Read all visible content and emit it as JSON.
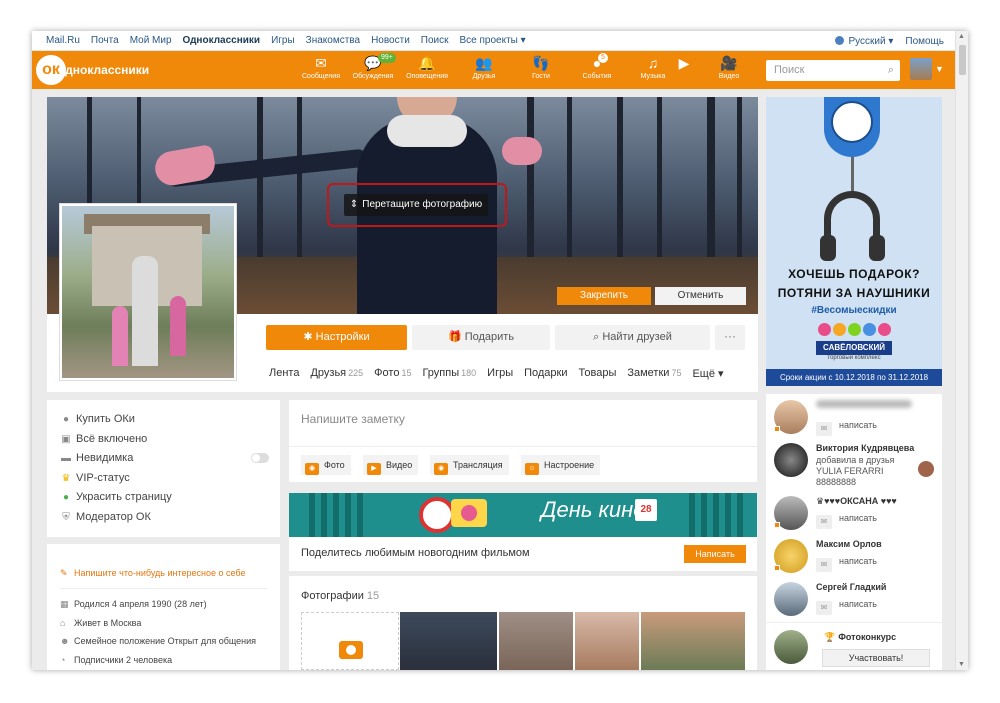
{
  "toplinks": {
    "items": [
      "Mail.Ru",
      "Почта",
      "Мой Мир",
      "Одноклассники",
      "Игры",
      "Знакомства",
      "Новости",
      "Поиск",
      "Все проекты ▾"
    ],
    "language": "Русский ▾",
    "help": "Помощь"
  },
  "header": {
    "logo_text": "одноклассники",
    "nav": [
      {
        "label": "Сообщения",
        "icon": "envelope-icon"
      },
      {
        "label": "Обсуждения",
        "icon": "chat-icon",
        "badge": "99+"
      },
      {
        "label": "Оповещения",
        "icon": "bell-icon"
      },
      {
        "label": "Друзья",
        "icon": "friends-icon"
      },
      {
        "label": "Гости",
        "icon": "footprints-icon"
      },
      {
        "label": "События",
        "icon": "events-icon",
        "badge": "5"
      },
      {
        "label": "Музыка",
        "icon": "music-icon"
      },
      {
        "label": "Видео",
        "icon": "video-icon"
      }
    ],
    "search_placeholder": "Поиск"
  },
  "cover": {
    "drag_label": "Перетащите фотографию",
    "fix_label": "Закрепить",
    "cancel_label": "Отменить"
  },
  "profile": {
    "settings_label": "Настройки",
    "gift_label": "Подарить",
    "find_friends_label": "Найти друзей",
    "more_label": "···",
    "tabs": [
      {
        "label": "Лента",
        "count": ""
      },
      {
        "label": "Друзья",
        "count": "225"
      },
      {
        "label": "Фото",
        "count": "15"
      },
      {
        "label": "Группы",
        "count": "180"
      },
      {
        "label": "Игры",
        "count": ""
      },
      {
        "label": "Подарки",
        "count": ""
      },
      {
        "label": "Товары",
        "count": ""
      },
      {
        "label": "Заметки",
        "count": "75"
      },
      {
        "label": "Ещё ▾",
        "count": ""
      }
    ]
  },
  "ad": {
    "line1": "ХОЧЕШЬ ПОДАРОК?",
    "line2": "ПОТЯНИ ЗА НАУШНИКИ",
    "hashtag": "#Весомыескидки",
    "brand": "САВЁЛОВСКИЙ",
    "brand_sub": "торговый комплекс",
    "footer": "Сроки акции с 10.12.2018 по 31.12.2018"
  },
  "left_menu": {
    "items": [
      {
        "label": "Купить ОКи",
        "icon": "ok-coin-icon"
      },
      {
        "label": "Всё включено",
        "icon": "bundle-icon"
      },
      {
        "label": "Невидимка",
        "icon": "hat-icon"
      },
      {
        "label": "VIP-статус",
        "icon": "crown-icon"
      },
      {
        "label": "Украсить страницу",
        "icon": "palette-icon"
      },
      {
        "label": "Модератор ОК",
        "icon": "shield-icon"
      }
    ]
  },
  "about": {
    "prompt": "Напишите что-нибудь интересное о себе",
    "items": [
      {
        "label": "Родился 4 апреля 1990 (28 лет)",
        "icon": "calendar-icon"
      },
      {
        "label": "Живет в Москва",
        "icon": "home-icon"
      },
      {
        "label": "Семейное положение Открыт для общения",
        "icon": "people-icon"
      },
      {
        "label": "Подписчики 2 человека",
        "icon": "rss-icon"
      }
    ]
  },
  "note": {
    "placeholder": "Напишите заметку",
    "buttons": [
      "Фото",
      "Видео",
      "Трансляция",
      "Настроение"
    ]
  },
  "banner": {
    "title": "День кино",
    "calendar_day": "28",
    "caption": "Поделитесь любимым новогодним фильмом",
    "button": "Написать"
  },
  "photos": {
    "title": "Фотографии",
    "count": "15"
  },
  "friends": {
    "items": [
      {
        "name": "",
        "sub": "",
        "write": "написать"
      },
      {
        "name": "Виктория Кудрявцева",
        "sub": "добавила в друзья",
        "sub2": "YULIA FERARRI",
        "sub3": "88888888"
      },
      {
        "name": "♛♥♥♥ОКСАНА ♥♥♥",
        "write": "написать"
      },
      {
        "name": "Максим Орлов",
        "write": "написать"
      },
      {
        "name": "Сергей Гладкий",
        "write": "написать"
      }
    ],
    "contest": "Фотоконкурс",
    "contest_button": "Участвовать!"
  },
  "colors": {
    "accent": "#f0880a",
    "link": "#2a5885"
  }
}
